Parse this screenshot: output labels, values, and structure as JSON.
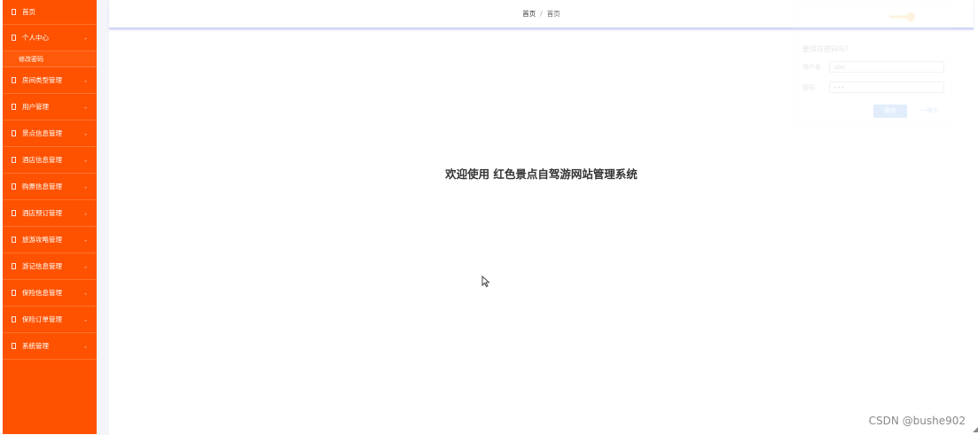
{
  "sidebar": {
    "items": [
      {
        "label": "首页",
        "has_arrow": false
      },
      {
        "label": "个人中心",
        "has_arrow": true,
        "sub": [
          "修改密码"
        ]
      },
      {
        "label": "房间类型管理",
        "has_arrow": true
      },
      {
        "label": "用户管理",
        "has_arrow": true
      },
      {
        "label": "景点信息管理",
        "has_arrow": true
      },
      {
        "label": "酒店信息管理",
        "has_arrow": true
      },
      {
        "label": "购票信息管理",
        "has_arrow": true
      },
      {
        "label": "酒店预订管理",
        "has_arrow": true
      },
      {
        "label": "旅游攻略管理",
        "has_arrow": true
      },
      {
        "label": "游记信息管理",
        "has_arrow": true
      },
      {
        "label": "保险信息管理",
        "has_arrow": true
      },
      {
        "label": "保险订单管理",
        "has_arrow": true
      },
      {
        "label": "系统管理",
        "has_arrow": true
      }
    ],
    "arrow_glyph": "⌄"
  },
  "header": {
    "breadcrumb": [
      "首页",
      "首页"
    ],
    "separator": "/"
  },
  "main": {
    "welcome": "欢迎使用 红色景点自驾游网站管理系统"
  },
  "ghost_dialog": {
    "title": "要保存密码吗?",
    "username_label": "用户名",
    "username_value": "abo",
    "password_label": "密码",
    "password_value": "•••",
    "save_label": "保存",
    "never_label": "一律不"
  },
  "watermark": "CSDN @bushe902",
  "colors": {
    "sidebar": "#ff5200",
    "header_border": "#cfd6f5",
    "gutter": "#f3f5f8",
    "text": "#333333"
  }
}
